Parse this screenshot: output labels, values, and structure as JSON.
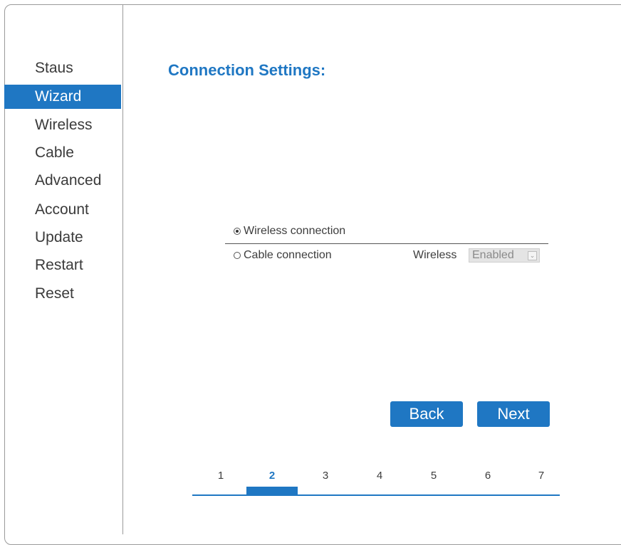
{
  "sidebar": {
    "items": [
      {
        "label": "Staus",
        "active": false
      },
      {
        "label": "Wizard",
        "active": true
      },
      {
        "label": "Wireless",
        "active": false
      },
      {
        "label": "Cable",
        "active": false
      },
      {
        "label": "Advanced",
        "active": false
      },
      {
        "label": "Account",
        "active": false
      },
      {
        "label": "Update",
        "active": false
      },
      {
        "label": "Restart",
        "active": false
      },
      {
        "label": "Reset",
        "active": false
      }
    ]
  },
  "main": {
    "title": "Connection Settings:",
    "options": [
      {
        "label": "Wireless connection",
        "selected": true
      },
      {
        "label": "Cable connection",
        "selected": false
      }
    ],
    "wireless_label": "Wireless",
    "wireless_select": {
      "value": "Enabled"
    },
    "buttons": {
      "back": "Back",
      "next": "Next"
    },
    "steps": [
      "1",
      "2",
      "3",
      "4",
      "5",
      "6",
      "7"
    ],
    "current_step": "2"
  },
  "colors": {
    "accent": "#1f77c3",
    "text": "#3a3a3a",
    "border": "#9a9a9a"
  },
  "icons": {
    "radio_selected": "radio-checked-icon",
    "radio_unselected": "radio-unchecked-icon",
    "select_arrow": "chevron-down-icon"
  }
}
